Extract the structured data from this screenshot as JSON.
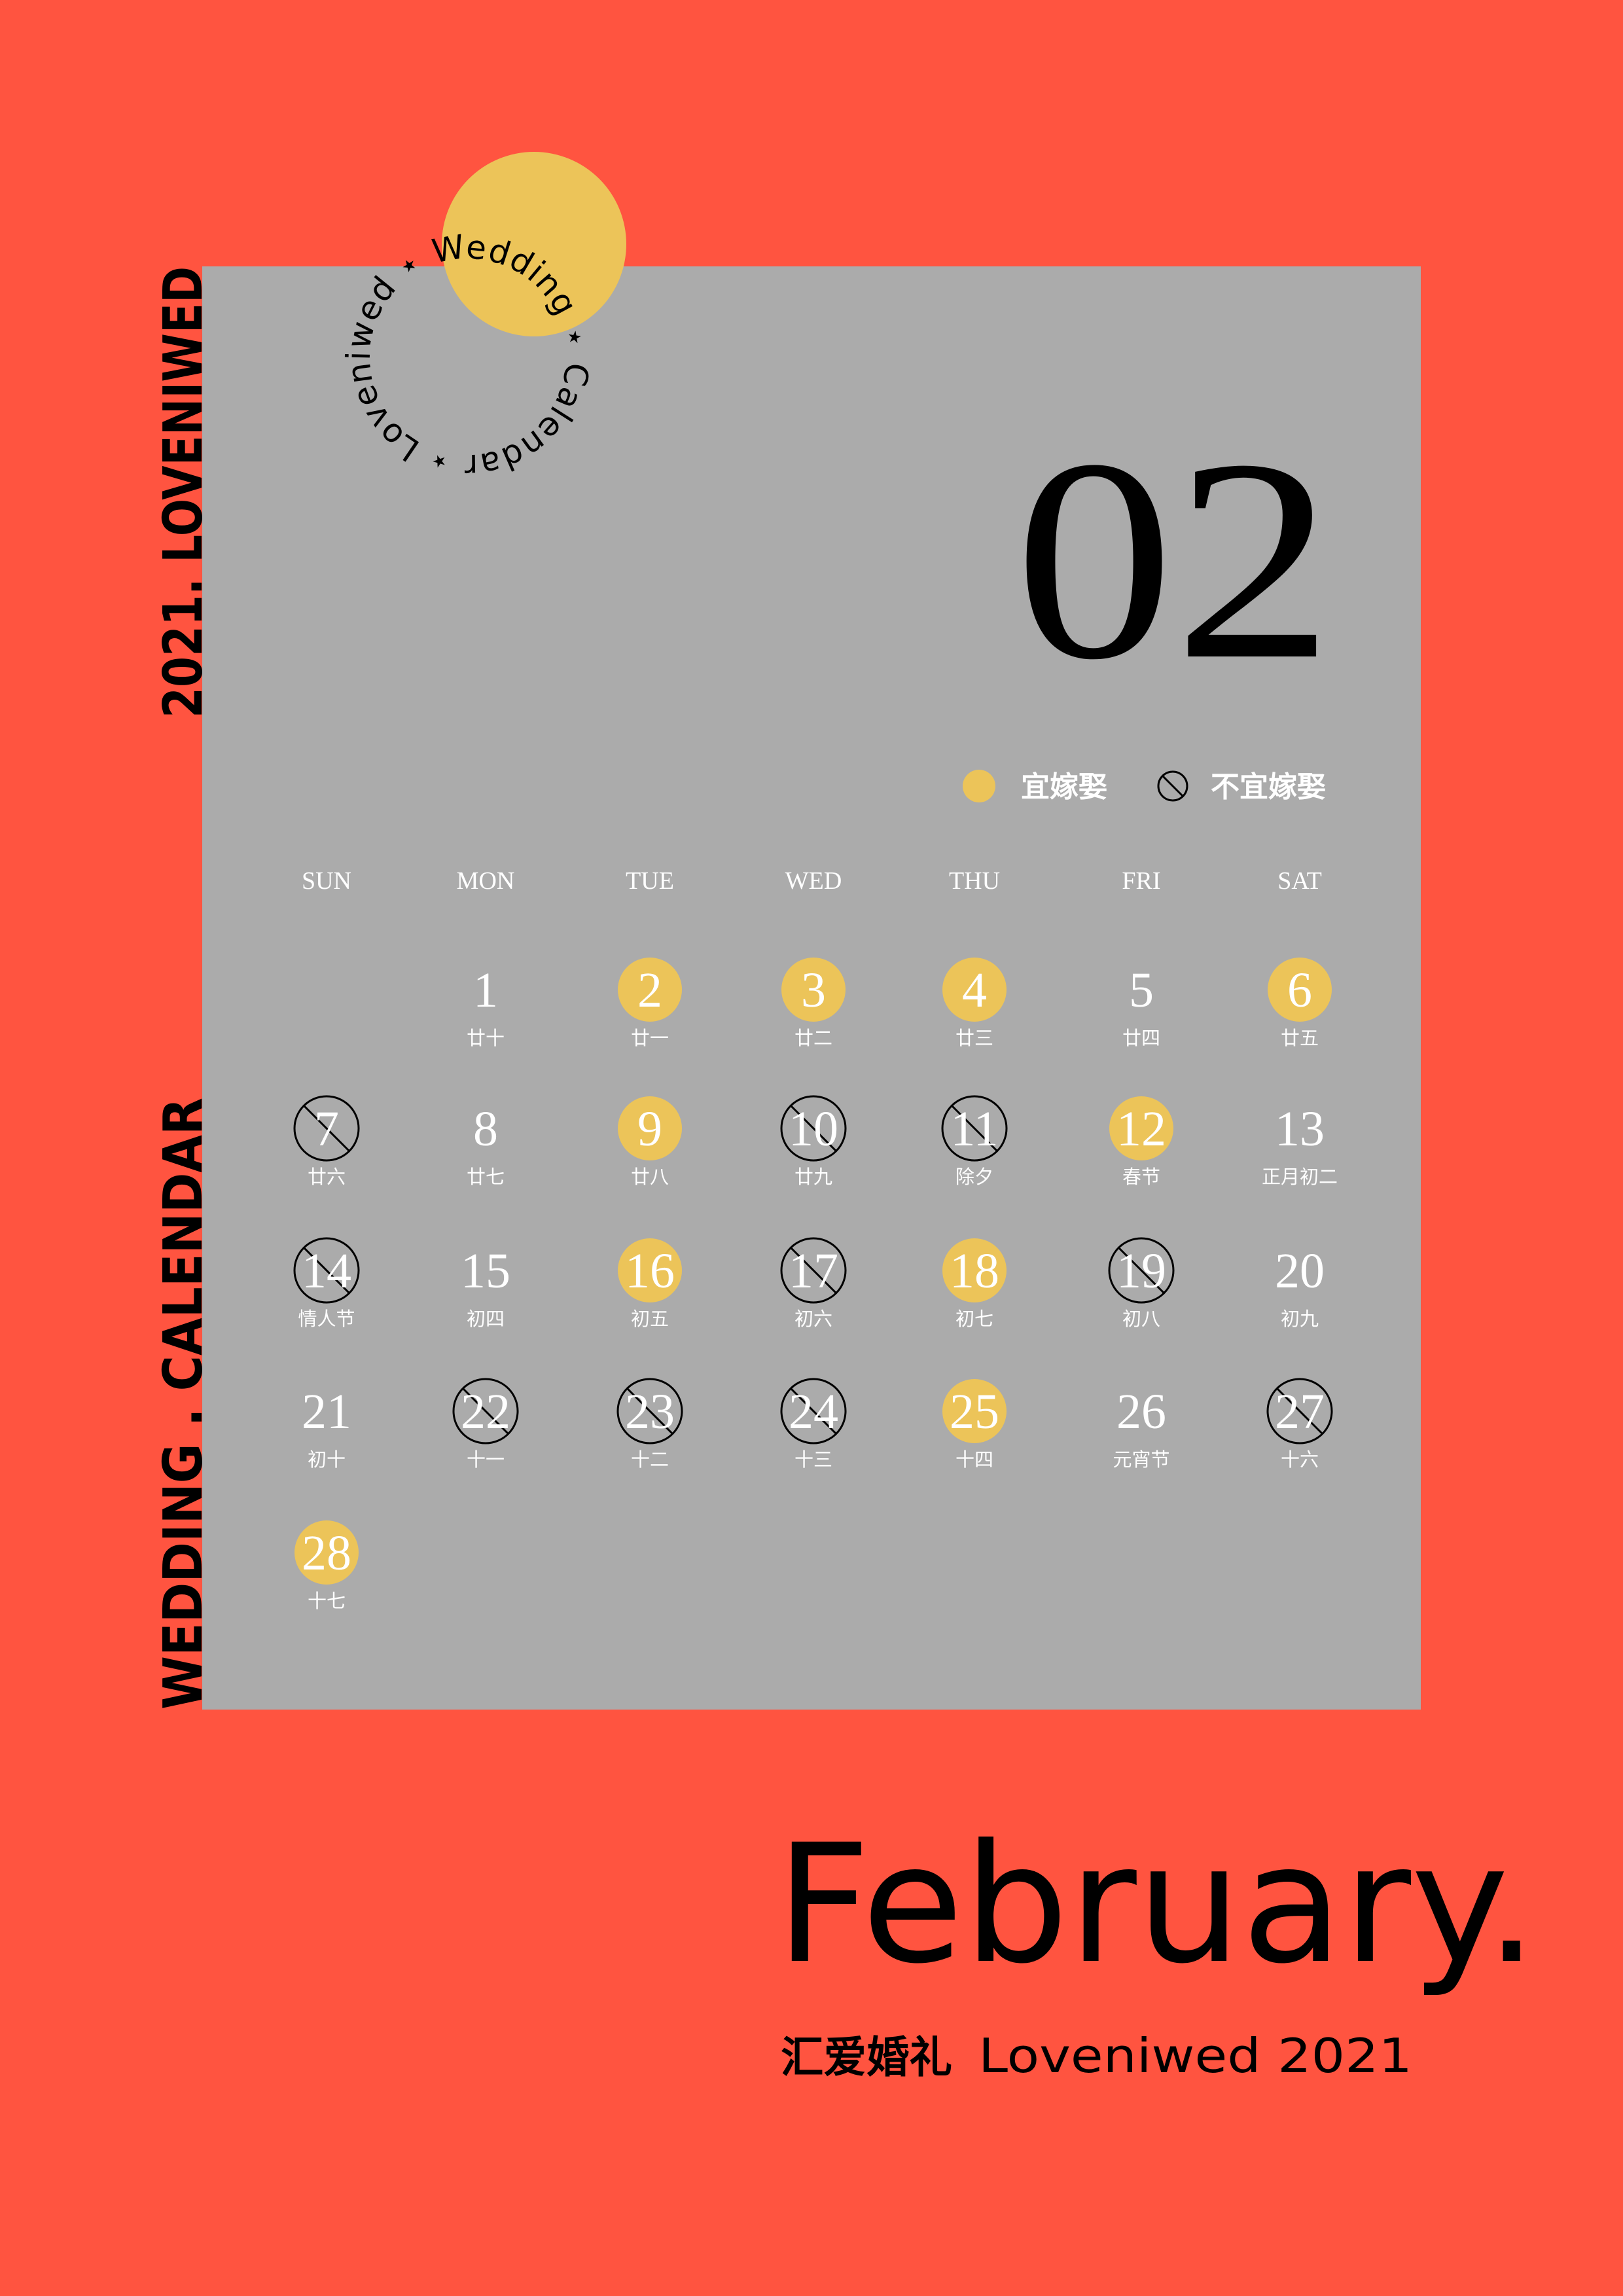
{
  "colors": {
    "background": "#FF5440",
    "panel": "#ABABAB",
    "good": "#ECC459",
    "text_light": "#FFFFFF",
    "text_dark": "#000000"
  },
  "side_text": {
    "top": "2021. LOVENIWED",
    "bottom": "WEDDING . CALENDAR"
  },
  "badge": {
    "ring_text": "Loveniwed ⋆ Wedding ⋆ Calendar ⋆"
  },
  "month_number": "02",
  "legend": {
    "good_label": "宜嫁娶",
    "bad_label": "不宜嫁娶",
    "good_icon": "yellow-dot-icon",
    "bad_icon": "prohibited-icon"
  },
  "weekdays": [
    "SUN",
    "MON",
    "TUE",
    "WED",
    "THU",
    "FRI",
    "SAT"
  ],
  "first_weekday_index": 1,
  "days": [
    {
      "day": "1",
      "lunar": "廿十",
      "status": "normal"
    },
    {
      "day": "2",
      "lunar": "廿一",
      "status": "good"
    },
    {
      "day": "3",
      "lunar": "廿二",
      "status": "good"
    },
    {
      "day": "4",
      "lunar": "廿三",
      "status": "good"
    },
    {
      "day": "5",
      "lunar": "廿四",
      "status": "normal"
    },
    {
      "day": "6",
      "lunar": "廿五",
      "status": "good"
    },
    {
      "day": "7",
      "lunar": "廿六",
      "status": "bad"
    },
    {
      "day": "8",
      "lunar": "廿七",
      "status": "normal"
    },
    {
      "day": "9",
      "lunar": "廿八",
      "status": "good"
    },
    {
      "day": "10",
      "lunar": "廿九",
      "status": "bad"
    },
    {
      "day": "11",
      "lunar": "除夕",
      "status": "bad"
    },
    {
      "day": "12",
      "lunar": "春节",
      "status": "good"
    },
    {
      "day": "13",
      "lunar": "正月初二",
      "status": "normal"
    },
    {
      "day": "14",
      "lunar": "情人节",
      "status": "bad"
    },
    {
      "day": "15",
      "lunar": "初四",
      "status": "normal"
    },
    {
      "day": "16",
      "lunar": "初五",
      "status": "good"
    },
    {
      "day": "17",
      "lunar": "初六",
      "status": "bad"
    },
    {
      "day": "18",
      "lunar": "初七",
      "status": "good"
    },
    {
      "day": "19",
      "lunar": "初八",
      "status": "bad"
    },
    {
      "day": "20",
      "lunar": "初九",
      "status": "normal"
    },
    {
      "day": "21",
      "lunar": "初十",
      "status": "normal"
    },
    {
      "day": "22",
      "lunar": "十一",
      "status": "bad"
    },
    {
      "day": "23",
      "lunar": "十二",
      "status": "bad"
    },
    {
      "day": "24",
      "lunar": "十三",
      "status": "bad"
    },
    {
      "day": "25",
      "lunar": "十四",
      "status": "good"
    },
    {
      "day": "26",
      "lunar": "元宵节",
      "status": "normal"
    },
    {
      "day": "27",
      "lunar": "十六",
      "status": "bad"
    },
    {
      "day": "28",
      "lunar": "十七",
      "status": "good"
    }
  ],
  "month_name": "February.",
  "footer": {
    "brand_cn": "汇爱婚礼",
    "brand_en": "Loveniwed 2021"
  }
}
